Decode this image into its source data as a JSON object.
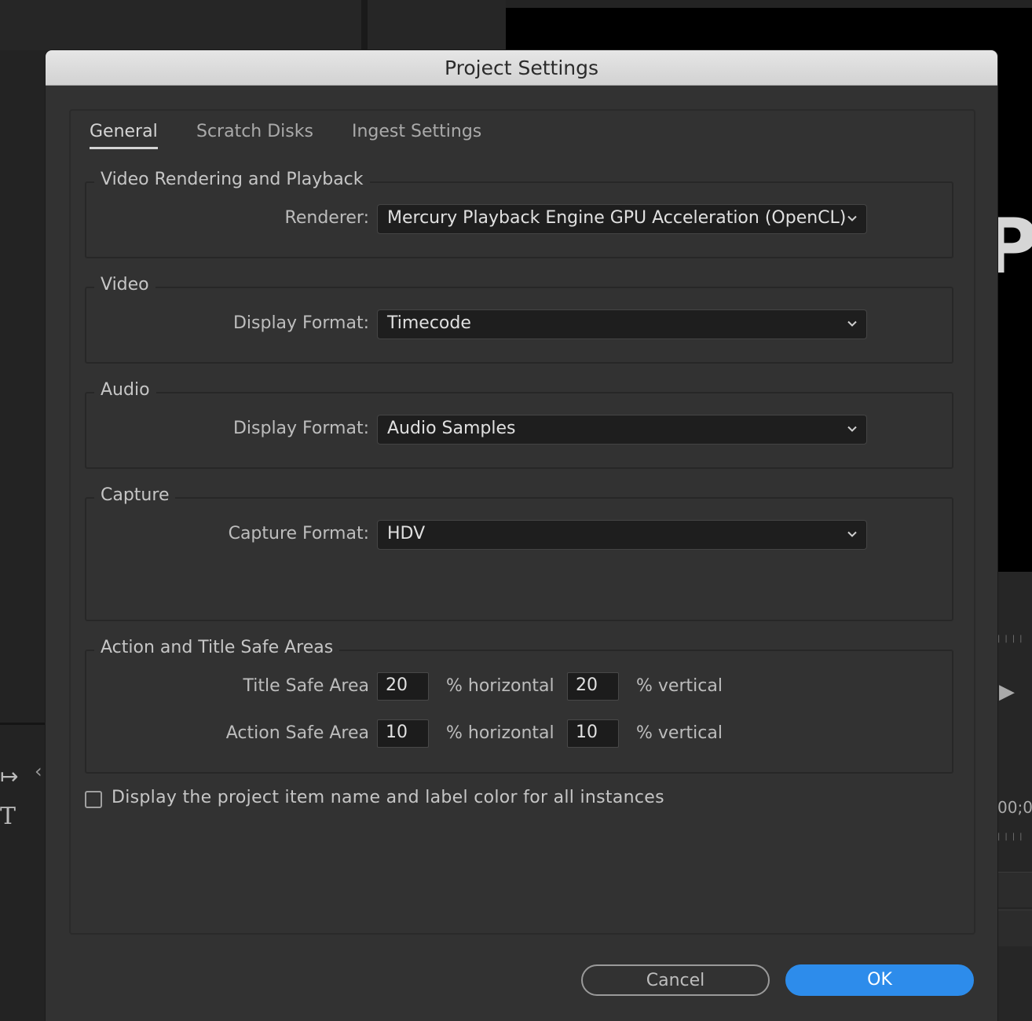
{
  "background": {
    "monitor_text": "P",
    "timecode_fragment": "00;0"
  },
  "dialog": {
    "title": "Project Settings",
    "tabs": [
      {
        "label": "General",
        "active": true
      },
      {
        "label": "Scratch Disks",
        "active": false
      },
      {
        "label": "Ingest Settings",
        "active": false
      }
    ],
    "rendering": {
      "title": "Video Rendering and Playback",
      "renderer_label": "Renderer:",
      "renderer_value": "Mercury Playback Engine GPU Acceleration (OpenCL)"
    },
    "video": {
      "title": "Video",
      "display_format_label": "Display Format:",
      "display_format_value": "Timecode"
    },
    "audio": {
      "title": "Audio",
      "display_format_label": "Display Format:",
      "display_format_value": "Audio Samples"
    },
    "capture": {
      "title": "Capture",
      "capture_format_label": "Capture Format:",
      "capture_format_value": "HDV"
    },
    "safe_areas": {
      "title": "Action and Title Safe Areas",
      "title_safe": {
        "label": "Title Safe Area",
        "horizontal": "20",
        "horizontal_unit": "% horizontal",
        "vertical": "20",
        "vertical_unit": "% vertical"
      },
      "action_safe": {
        "label": "Action Safe Area",
        "horizontal": "10",
        "horizontal_unit": "% horizontal",
        "vertical": "10",
        "vertical_unit": "% vertical"
      }
    },
    "display_label_checkbox": {
      "label": "Display the project item name and label color for all instances",
      "checked": false
    },
    "buttons": {
      "cancel": "Cancel",
      "ok": "OK"
    },
    "colors": {
      "ok_button": "#2d8ceb",
      "dialog_bg": "#323232",
      "titlebar": "#dcdcdc"
    }
  }
}
